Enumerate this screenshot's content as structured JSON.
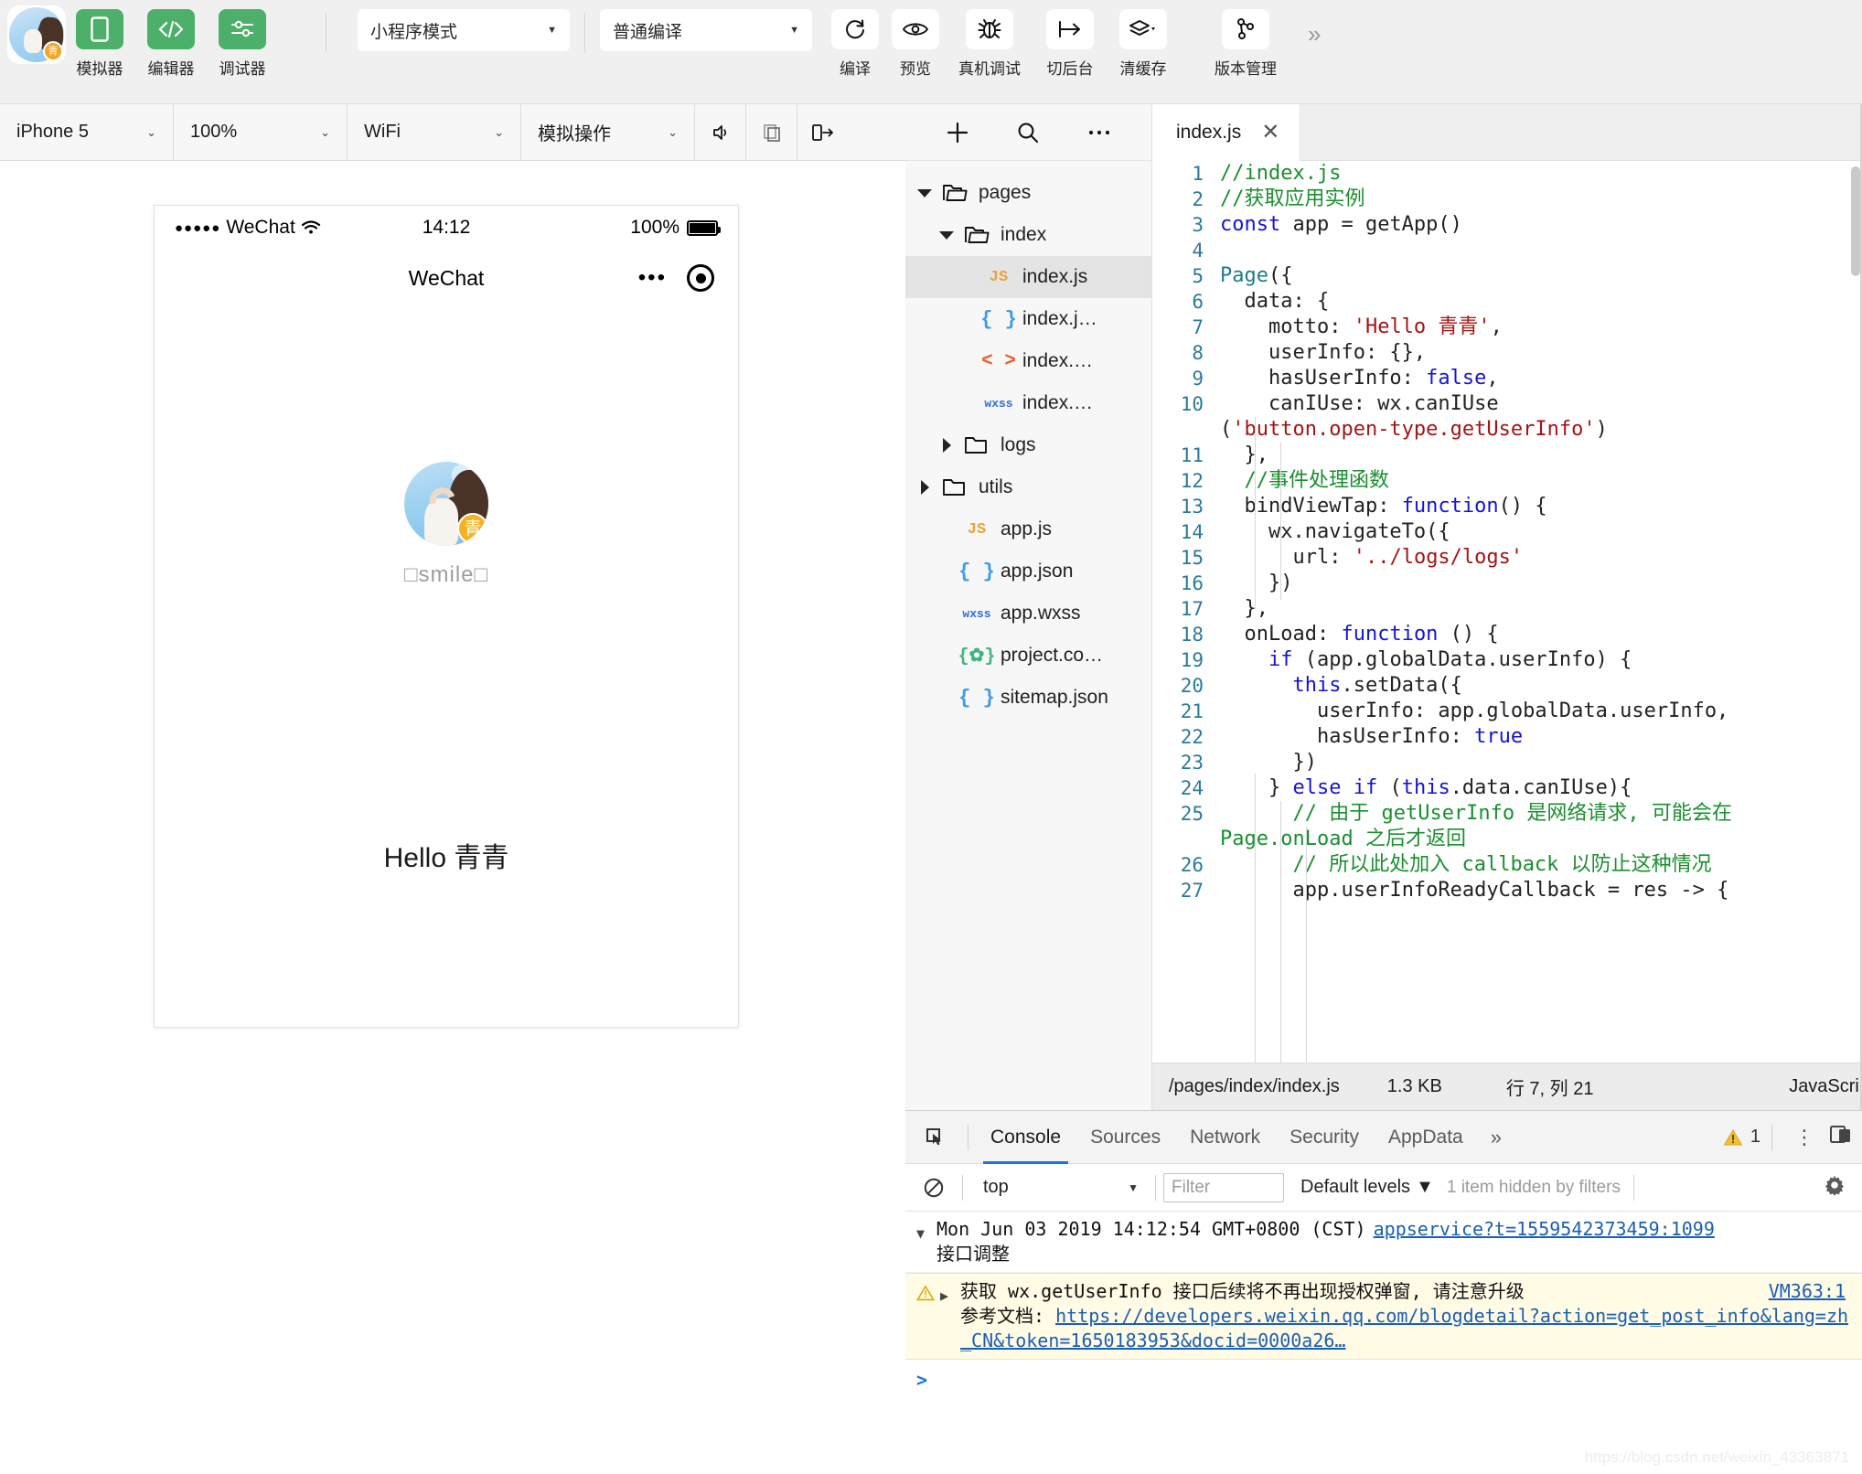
{
  "toolbar": {
    "avatar_badge": "青",
    "items": [
      {
        "label": "模拟器",
        "icon": "phone-icon",
        "green": true
      },
      {
        "label": "编辑器",
        "icon": "code-icon",
        "green": true
      },
      {
        "label": "调试器",
        "icon": "sliders-icon",
        "green": true
      }
    ],
    "mode_select": {
      "value": "小程序模式",
      "caret": "▼"
    },
    "compile_select": {
      "value": "普通编译",
      "caret": "▼"
    },
    "actions": [
      {
        "label": "编译",
        "icon": "refresh-icon"
      },
      {
        "label": "预览",
        "icon": "eye-icon"
      },
      {
        "label": "真机调试",
        "icon": "bug-icon"
      },
      {
        "label": "切后台",
        "icon": "background-icon"
      },
      {
        "label": "清缓存",
        "icon": "layers-icon"
      },
      {
        "label": "版本管理",
        "icon": "branch-icon"
      }
    ],
    "overflow": "»"
  },
  "devicebar": {
    "device": {
      "value": "iPhone 5",
      "caret": "⌄"
    },
    "zoom": {
      "value": "100%",
      "caret": "⌄"
    },
    "network": {
      "value": "WiFi",
      "caret": "⌄"
    },
    "simulate": {
      "value": "模拟操作",
      "caret": "⌄"
    },
    "icons": [
      "volume-icon",
      "copy-icon",
      "rotate-icon"
    ]
  },
  "simulator": {
    "status_bar": {
      "signal_dots": "●●●●●",
      "carrier": "WeChat",
      "wifi_icon": "wifi-icon",
      "time": "14:12",
      "battery_pct": "100%"
    },
    "nav": {
      "title": "WeChat",
      "capsule_dots": "•••",
      "capsule_target": "target-icon"
    },
    "user": {
      "name": "□smile□",
      "avatar": "user-avatar-photo",
      "badge": "青"
    },
    "motto": "Hello 青青"
  },
  "explorer": {
    "toolbar": {
      "add": "+",
      "search": "search-icon",
      "more": "…"
    },
    "tree": [
      {
        "name": "pages",
        "indent": 0,
        "twisty": "down",
        "icon": "folder-open-icon",
        "icon_class": "",
        "selected": false
      },
      {
        "name": "index",
        "indent": 1,
        "twisty": "down",
        "icon": "folder-open-icon",
        "icon_class": "",
        "selected": false
      },
      {
        "name": "index.js",
        "indent": 2,
        "twisty": "none",
        "icon": "JS",
        "icon_class": "c-js",
        "selected": true
      },
      {
        "name": "index.j…",
        "indent": 2,
        "twisty": "none",
        "icon": "{ }",
        "icon_class": "c-json",
        "selected": false
      },
      {
        "name": "index.…",
        "indent": 2,
        "twisty": "none",
        "icon": "< >",
        "icon_class": "c-wxml",
        "selected": false
      },
      {
        "name": "index.…",
        "indent": 2,
        "twisty": "none",
        "icon": "wxss",
        "icon_class": "c-wxss",
        "selected": false
      },
      {
        "name": "logs",
        "indent": 1,
        "twisty": "right",
        "icon": "folder-icon",
        "icon_class": "",
        "selected": false
      },
      {
        "name": "utils",
        "indent": 0,
        "twisty": "right",
        "icon": "folder-icon",
        "icon_class": "",
        "selected": false
      },
      {
        "name": "app.js",
        "indent": 1,
        "twisty": "none",
        "icon": "JS",
        "icon_class": "c-js",
        "selected": false
      },
      {
        "name": "app.json",
        "indent": 1,
        "twisty": "none",
        "icon": "{ }",
        "icon_class": "c-json",
        "selected": false
      },
      {
        "name": "app.wxss",
        "indent": 1,
        "twisty": "none",
        "icon": "wxss",
        "icon_class": "c-wxss",
        "selected": false
      },
      {
        "name": "project.co…",
        "indent": 1,
        "twisty": "none",
        "icon": "{✿}",
        "icon_class": "c-proj",
        "selected": false
      },
      {
        "name": "sitemap.json",
        "indent": 1,
        "twisty": "none",
        "icon": "{ }",
        "icon_class": "c-json",
        "selected": false
      }
    ]
  },
  "editor": {
    "tab": {
      "label": "index.js",
      "close": "✕"
    },
    "lines": [
      {
        "n": "1",
        "segs": [
          {
            "t": "//index.js",
            "c": "tok-com"
          }
        ]
      },
      {
        "n": "2",
        "segs": [
          {
            "t": "//获取应用实例",
            "c": "tok-com"
          }
        ]
      },
      {
        "n": "3",
        "segs": [
          {
            "t": "const",
            "c": "tok-key"
          },
          {
            "t": " app = getApp()",
            "c": ""
          }
        ]
      },
      {
        "n": "4",
        "segs": [
          {
            "t": "",
            "c": ""
          }
        ]
      },
      {
        "n": "5",
        "segs": [
          {
            "t": "Page",
            "c": "tok-fn"
          },
          {
            "t": "({",
            "c": ""
          }
        ]
      },
      {
        "n": "6",
        "segs": [
          {
            "t": "  data: {",
            "c": ""
          }
        ]
      },
      {
        "n": "7",
        "segs": [
          {
            "t": "    motto: ",
            "c": ""
          },
          {
            "t": "'Hello 青青'",
            "c": "tok-str"
          },
          {
            "t": ",",
            "c": ""
          }
        ]
      },
      {
        "n": "8",
        "segs": [
          {
            "t": "    userInfo: {},",
            "c": ""
          }
        ]
      },
      {
        "n": "9",
        "segs": [
          {
            "t": "    hasUserInfo: ",
            "c": ""
          },
          {
            "t": "false",
            "c": "tok-key"
          },
          {
            "t": ",",
            "c": ""
          }
        ]
      },
      {
        "n": "10",
        "segs": [
          {
            "t": "    canIUse: wx.canIUse",
            "c": ""
          }
        ]
      },
      {
        "n": "",
        "cont": true,
        "segs": [
          {
            "t": "(",
            "c": ""
          },
          {
            "t": "'button.open-type.getUserInfo'",
            "c": "tok-str"
          },
          {
            "t": ")",
            "c": ""
          }
        ]
      },
      {
        "n": "11",
        "segs": [
          {
            "t": "  },",
            "c": ""
          }
        ]
      },
      {
        "n": "12",
        "segs": [
          {
            "t": "  //事件处理函数",
            "c": "tok-com"
          }
        ]
      },
      {
        "n": "13",
        "segs": [
          {
            "t": "  bindViewTap: ",
            "c": ""
          },
          {
            "t": "function",
            "c": "tok-key"
          },
          {
            "t": "() {",
            "c": ""
          }
        ]
      },
      {
        "n": "14",
        "segs": [
          {
            "t": "    wx.navigateTo({",
            "c": ""
          }
        ]
      },
      {
        "n": "15",
        "segs": [
          {
            "t": "      url: ",
            "c": ""
          },
          {
            "t": "'../logs/logs'",
            "c": "tok-str"
          }
        ]
      },
      {
        "n": "16",
        "segs": [
          {
            "t": "    })",
            "c": ""
          }
        ]
      },
      {
        "n": "17",
        "segs": [
          {
            "t": "  },",
            "c": ""
          }
        ]
      },
      {
        "n": "18",
        "segs": [
          {
            "t": "  onLoad: ",
            "c": ""
          },
          {
            "t": "function",
            "c": "tok-key"
          },
          {
            "t": " () {",
            "c": ""
          }
        ]
      },
      {
        "n": "19",
        "segs": [
          {
            "t": "    ",
            "c": ""
          },
          {
            "t": "if",
            "c": "tok-key"
          },
          {
            "t": " (app.globalData.userInfo) {",
            "c": ""
          }
        ]
      },
      {
        "n": "20",
        "segs": [
          {
            "t": "      ",
            "c": ""
          },
          {
            "t": "this",
            "c": "tok-key"
          },
          {
            "t": ".setData({",
            "c": ""
          }
        ]
      },
      {
        "n": "21",
        "segs": [
          {
            "t": "        userInfo: app.globalData.userInfo,",
            "c": ""
          }
        ]
      },
      {
        "n": "22",
        "segs": [
          {
            "t": "        hasUserInfo: ",
            "c": ""
          },
          {
            "t": "true",
            "c": "tok-key"
          }
        ]
      },
      {
        "n": "23",
        "segs": [
          {
            "t": "      })",
            "c": ""
          }
        ]
      },
      {
        "n": "24",
        "segs": [
          {
            "t": "    } ",
            "c": ""
          },
          {
            "t": "else if",
            "c": "tok-key"
          },
          {
            "t": " (",
            "c": ""
          },
          {
            "t": "this",
            "c": "tok-key"
          },
          {
            "t": ".data.canIUse){",
            "c": ""
          }
        ]
      },
      {
        "n": "25",
        "segs": [
          {
            "t": "      // 由于 getUserInfo 是网络请求, 可能会在",
            "c": "tok-com"
          }
        ]
      },
      {
        "n": "",
        "cont": true,
        "segs": [
          {
            "t": "Page.onLoad 之后才返回",
            "c": "tok-com"
          }
        ]
      },
      {
        "n": "26",
        "segs": [
          {
            "t": "      // 所以此处加入 callback 以防止这种情况",
            "c": "tok-com"
          }
        ]
      },
      {
        "n": "27",
        "segs": [
          {
            "t": "      app.userInfoReadyCallback = res -> {",
            "c": ""
          }
        ]
      }
    ],
    "status": {
      "path": "/pages/index/index.js",
      "size": "1.3 KB",
      "position": "行 7, 列 21",
      "language": "JavaScrip"
    }
  },
  "devtools": {
    "inspect_icon": "inspect-icon",
    "tabs": [
      {
        "label": "Console",
        "active": true
      },
      {
        "label": "Sources",
        "active": false
      },
      {
        "label": "Network",
        "active": false
      },
      {
        "label": "Security",
        "active": false
      },
      {
        "label": "AppData",
        "active": false
      }
    ],
    "tabs_overflow": "»",
    "warning_count": "1",
    "kebab": "⋮",
    "dock_icon": "dock-icon",
    "filterbar": {
      "clear_icon": "clear-icon",
      "context": "top",
      "context_caret": "▼",
      "filter_placeholder": "Filter",
      "levels": "Default levels",
      "levels_caret": "▼",
      "hidden_note": "1 item hidden by filters",
      "settings_icon": "gear-icon"
    },
    "logs": [
      {
        "type": "info",
        "arrow": "▼",
        "text": "Mon Jun 03 2019 14:12:54 GMT+0800 (CST)",
        "source": "appservice?t=1559542373459:1099",
        "second_line": "接口调整"
      },
      {
        "type": "warning",
        "icon": "warning-icon",
        "arrow": "▶",
        "text": "获取 wx.getUserInfo 接口后续将不再出现授权弹窗, 请注意升级",
        "source": "VM363:1",
        "doc_label": "参考文档: ",
        "doc_link": "https://developers.weixin.qq.com/blogdetail?action=get_post_info&lang=zh_CN&token=1650183953&docid=0000a26…"
      }
    ],
    "prompt": ">"
  },
  "watermark": "https://blog.csdn.net/weixin_43363871",
  "colors": {
    "accent_green": "#4caf6a",
    "tab_active_blue": "#1a73e8",
    "warning_bg": "#fffbe5",
    "link_blue": "#1a5fb4"
  }
}
